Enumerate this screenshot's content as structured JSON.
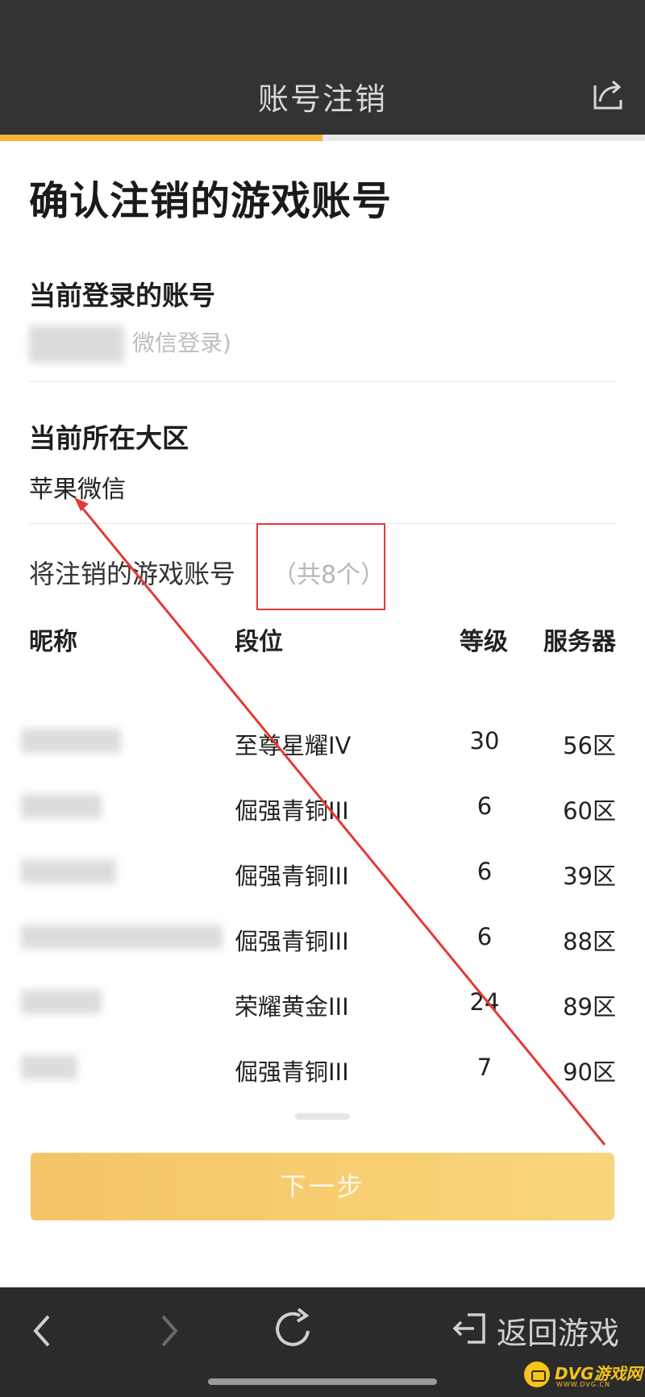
{
  "header": {
    "title": "账号注销",
    "share_icon": "share-icon"
  },
  "progress": {
    "fraction": 0.5,
    "color": "#f4b13c",
    "track": "#e9e9e9"
  },
  "page": {
    "heading": "确认注销的游戏账号",
    "login_label": "当前登录的账号",
    "login_value": "微信登录)",
    "region_label": "当前所在大区",
    "region_value": "苹果微信",
    "to_close_label": "将注销的游戏账号",
    "to_close_count": "（共8个）"
  },
  "table": {
    "headers": {
      "nickname": "昵称",
      "rank": "段位",
      "level": "等级",
      "server": "服务器"
    },
    "rows": [
      {
        "rank": "至尊星耀IV",
        "level": "30",
        "server": "56区"
      },
      {
        "rank": "倔强青铜III",
        "level": "6",
        "server": "60区"
      },
      {
        "rank": "倔强青铜III",
        "level": "6",
        "server": "39区"
      },
      {
        "rank": "倔强青铜III",
        "level": "6",
        "server": "88区"
      },
      {
        "rank": "荣耀黄金III",
        "level": "24",
        "server": "89区"
      },
      {
        "rank": "倔强青铜III",
        "level": "7",
        "server": "90区"
      }
    ]
  },
  "actions": {
    "next_label": "下一步"
  },
  "bottom_nav": {
    "back_icon": "chevron-left-icon",
    "forward_icon": "chevron-right-icon",
    "refresh_icon": "refresh-icon",
    "return_icon": "exit-icon",
    "return_label": "返回游戏"
  },
  "watermark": {
    "text": "DVG游戏网",
    "sub": "WWW.DVG.CN"
  },
  "colors": {
    "accent": "#f4b13c",
    "annotation": "#e53935",
    "bar_bg": "#333333"
  }
}
